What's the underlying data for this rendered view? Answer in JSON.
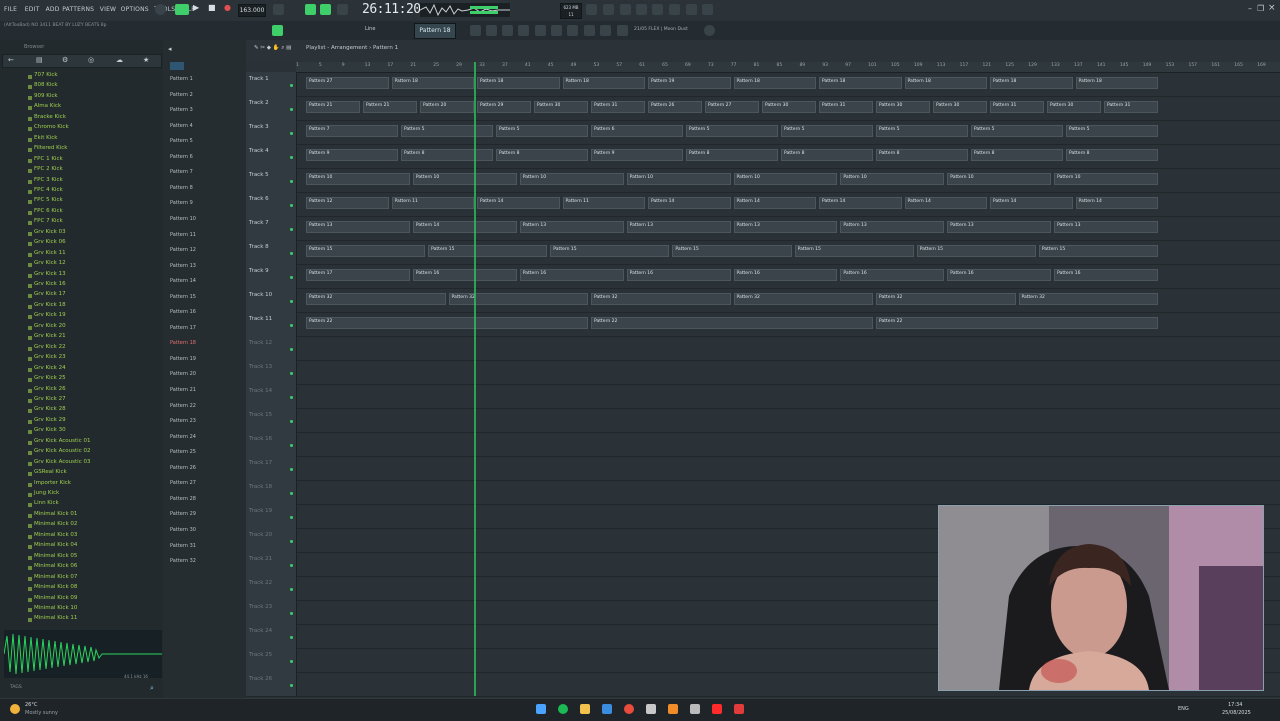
{
  "menu": [
    "FILE",
    "EDIT",
    "ADD",
    "PATTERNS",
    "VIEW",
    "OPTIONS",
    "TOOLS",
    "HELP"
  ],
  "header": {
    "project_hint": "(AltTooBad) NO 3411 BEAT BY LUZY BEATS 8p",
    "tempo": "163.000",
    "time": "26:11:20",
    "pattern_selector": "Pattern 18",
    "line_mode": "Line",
    "mixer_hint": "21/05 FLEX | Moon Dust"
  },
  "breadcrumb": {
    "playlist": "Playlist - Arrangement",
    "pattern": "Pattern 1"
  },
  "browser": {
    "title": "Browser",
    "items": [
      "707 Kick",
      "808 Kick",
      "909 Kick",
      "Alma Kick",
      "Bracke Kick",
      "Chromo Kick",
      "Ekit Kick",
      "Filtered Kick",
      "FPC 1 Kick",
      "FPC 2 Kick",
      "FPC 3 Kick",
      "FPC 4 Kick",
      "FPC 5 Kick",
      "FPC 6 Kick",
      "FPC 7 Kick",
      "Grv Kick 03",
      "Grv Kick 06",
      "Grv Kick 11",
      "Grv Kick 12",
      "Grv Kick 13",
      "Grv Kick 16",
      "Grv Kick 17",
      "Grv Kick 18",
      "Grv Kick 19",
      "Grv Kick 20",
      "Grv Kick 21",
      "Grv Kick 22",
      "Grv Kick 23",
      "Grv Kick 24",
      "Grv Kick 25",
      "Grv Kick 26",
      "Grv Kick 27",
      "Grv Kick 28",
      "Grv Kick 29",
      "Grv Kick 30",
      "Grv Kick Acoustic 01",
      "Grv Kick Acoustic 02",
      "Grv Kick Acoustic 03",
      "GSReal Kick",
      "Importer Kick",
      "Jung Kick",
      "Linn Kick",
      "Minimal Kick 01",
      "Minimal Kick 02",
      "Minimal Kick 03",
      "Minimal Kick 04",
      "Minimal Kick 05",
      "Minimal Kick 06",
      "Minimal Kick 07",
      "Minimal Kick 08",
      "Minimal Kick 09",
      "Minimal Kick 10",
      "Minimal Kick 11"
    ],
    "sample_info": "44.1 kHz 16",
    "tags_label": "TAGS"
  },
  "patterns": [
    "Pattern 1",
    "Pattern 2",
    "Pattern 3",
    "Pattern 4",
    "Pattern 5",
    "Pattern 6",
    "Pattern 7",
    "Pattern 8",
    "Pattern 9",
    "Pattern 10",
    "Pattern 11",
    "Pattern 12",
    "Pattern 13",
    "Pattern 14",
    "Pattern 15",
    "Pattern 16",
    "Pattern 17",
    "Pattern 18",
    "Pattern 19",
    "Pattern 20",
    "Pattern 21",
    "Pattern 22",
    "Pattern 23",
    "Pattern 24",
    "Pattern 25",
    "Pattern 26",
    "Pattern 27",
    "Pattern 28",
    "Pattern 29",
    "Pattern 30",
    "Pattern 31",
    "Pattern 32"
  ],
  "active_pattern_index": 17,
  "tracks": [
    {
      "name": "Track 1",
      "clips": [
        "Pattern 27",
        "Pattern 18",
        "Pattern 18",
        "Pattern 18",
        "Pattern 19",
        "Pattern 18",
        "Pattern 18",
        "Pattern 18",
        "Pattern 18",
        "Pattern 18"
      ]
    },
    {
      "name": "Track 2",
      "clips": [
        "Pattern 21",
        "Pattern 21",
        "Pattern 20",
        "Pattern 29",
        "Pattern 30",
        "Pattern 31",
        "Pattern 26",
        "Pattern 27",
        "Pattern 30",
        "Pattern 31",
        "Pattern 30",
        "Pattern 30",
        "Pattern 31",
        "Pattern 30",
        "Pattern 31"
      ]
    },
    {
      "name": "Track 3",
      "clips": [
        "Pattern 7",
        "Pattern 5",
        "Pattern 5",
        "Pattern 6",
        "Pattern 5",
        "Pattern 5",
        "Pattern 5",
        "Pattern 5",
        "Pattern 5"
      ]
    },
    {
      "name": "Track 4",
      "clips": [
        "Pattern 9",
        "Pattern 8",
        "Pattern 8",
        "Pattern 9",
        "Pattern 8",
        "Pattern 8",
        "Pattern 8",
        "Pattern 8",
        "Pattern 8"
      ]
    },
    {
      "name": "Track 5",
      "clips": [
        "Pattern 10",
        "Pattern 10",
        "Pattern 10",
        "Pattern 10",
        "Pattern 10",
        "Pattern 10",
        "Pattern 10",
        "Pattern 10"
      ]
    },
    {
      "name": "Track 6",
      "clips": [
        "Pattern 12",
        "Pattern 11",
        "Pattern 14",
        "Pattern 11",
        "Pattern 14",
        "Pattern 14",
        "Pattern 14",
        "Pattern 14",
        "Pattern 14",
        "Pattern 14"
      ]
    },
    {
      "name": "Track 7",
      "clips": [
        "Pattern 13",
        "Pattern 14",
        "Pattern 13",
        "Pattern 13",
        "Pattern 13",
        "Pattern 13",
        "Pattern 13",
        "Pattern 13"
      ]
    },
    {
      "name": "Track 8",
      "clips": [
        "Pattern 15",
        "Pattern 15",
        "Pattern 15",
        "Pattern 15",
        "Pattern 15",
        "Pattern 15",
        "Pattern 15"
      ]
    },
    {
      "name": "Track 9",
      "clips": [
        "Pattern 17",
        "Pattern 16",
        "Pattern 16",
        "Pattern 16",
        "Pattern 16",
        "Pattern 16",
        "Pattern 16",
        "Pattern 16"
      ]
    },
    {
      "name": "Track 10",
      "clips": [
        "Pattern 32",
        "Pattern 32",
        "Pattern 32",
        "Pattern 32",
        "Pattern 32",
        "Pattern 32"
      ]
    },
    {
      "name": "Track 11",
      "clips": [
        "Pattern 22",
        "Pattern 22",
        "Pattern 22"
      ]
    },
    {
      "name": "Track 12",
      "clips": []
    },
    {
      "name": "Track 13",
      "clips": []
    },
    {
      "name": "Track 14",
      "clips": []
    },
    {
      "name": "Track 15",
      "clips": []
    },
    {
      "name": "Track 16",
      "clips": []
    },
    {
      "name": "Track 17",
      "clips": []
    },
    {
      "name": "Track 18",
      "clips": []
    },
    {
      "name": "Track 19",
      "clips": []
    },
    {
      "name": "Track 20",
      "clips": []
    },
    {
      "name": "Track 21",
      "clips": []
    },
    {
      "name": "Track 22",
      "clips": []
    },
    {
      "name": "Track 23",
      "clips": []
    },
    {
      "name": "Track 24",
      "clips": []
    },
    {
      "name": "Track 25",
      "clips": []
    },
    {
      "name": "Track 26",
      "clips": []
    }
  ],
  "ruler_bars": [
    "1",
    "5",
    "9",
    "13",
    "17",
    "21",
    "25",
    "29",
    "33",
    "37",
    "41",
    "45",
    "49",
    "53",
    "57",
    "61",
    "65",
    "69",
    "73",
    "77",
    "81",
    "85",
    "89",
    "93",
    "97",
    "101",
    "105",
    "109",
    "113",
    "117",
    "121",
    "125",
    "129",
    "133",
    "137",
    "141",
    "145",
    "149",
    "153",
    "157",
    "161",
    "165",
    "169"
  ],
  "taskbar": {
    "weather_temp": "26°C",
    "weather_desc": "Mostly sunny",
    "lang": "ENG",
    "clock_time": "17:34",
    "clock_date": "25/08/2025"
  },
  "colors": {
    "accent": "#3ecf6a",
    "browser_text": "#9fcf4f",
    "active_pattern": "#e56f6f"
  }
}
